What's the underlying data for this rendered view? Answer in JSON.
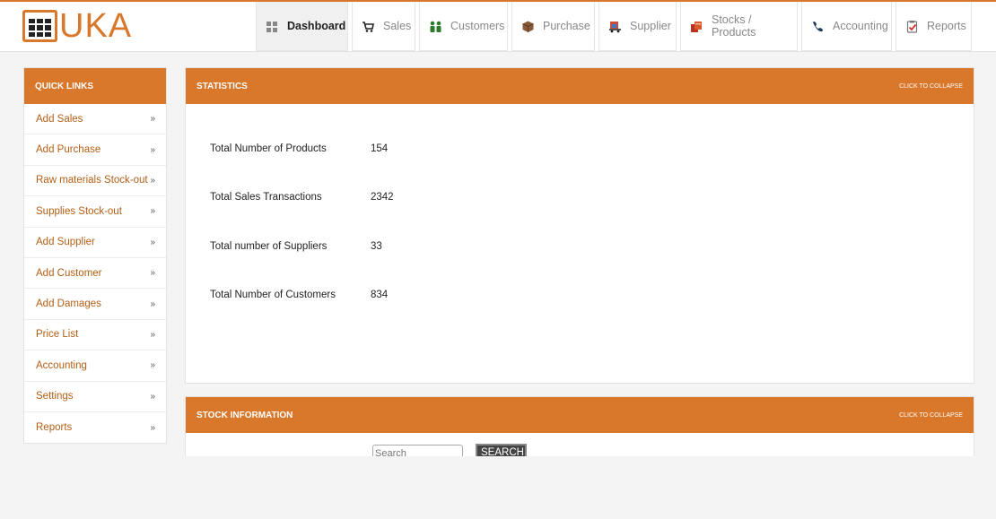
{
  "brand": {
    "logo_text": "UKA",
    "accent": "#d9772a"
  },
  "nav": [
    {
      "label": "Dashboard",
      "icon": "grid-icon",
      "active": true
    },
    {
      "label": "Sales",
      "icon": "cart-icon"
    },
    {
      "label": "Customers",
      "icon": "people-icon"
    },
    {
      "label": "Purchase",
      "icon": "box-icon"
    },
    {
      "label": "Supplier",
      "icon": "truck-icon"
    },
    {
      "label": "Stocks / Products",
      "icon": "books-icon"
    },
    {
      "label": "Accounting",
      "icon": "phone-icon"
    },
    {
      "label": "Reports",
      "icon": "clipboard-icon"
    }
  ],
  "sidebar": {
    "title": "QUICK LINKS",
    "items": [
      {
        "label": "Add Sales"
      },
      {
        "label": "Add Purchase"
      },
      {
        "label": "Raw materials Stock-out"
      },
      {
        "label": "Supplies Stock-out"
      },
      {
        "label": "Add Supplier"
      },
      {
        "label": "Add Customer"
      },
      {
        "label": "Add Damages"
      },
      {
        "label": "Price List"
      },
      {
        "label": "Accounting"
      },
      {
        "label": "Settings"
      },
      {
        "label": "Reports"
      }
    ],
    "chevron": "»"
  },
  "statistics": {
    "title": "STATISTICS",
    "collapse_label": "CLICK TO COLLAPSE",
    "rows": [
      {
        "label": "Total Number of Products",
        "value": "154"
      },
      {
        "label": "Total Sales Transactions",
        "value": "2342"
      },
      {
        "label": "Total number of Suppliers",
        "value": "33"
      },
      {
        "label": "Total Number of Customers",
        "value": "834"
      }
    ]
  },
  "stock": {
    "title": "STOCK INFORMATION",
    "collapse_label": "CLICK TO COLLAPSE",
    "search_placeholder": "Search",
    "search_button": "SEARCH"
  }
}
